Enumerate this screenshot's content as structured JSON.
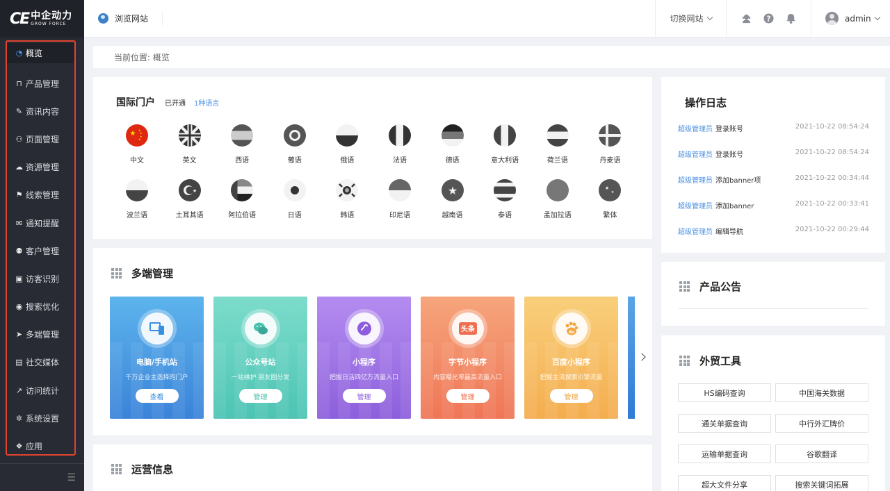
{
  "brand": {
    "mark": "CE",
    "name_cn": "中企动力",
    "name_en": "GROW FORCE"
  },
  "sidebar": {
    "items": [
      {
        "label": "概览",
        "icon": "dashboard-icon",
        "active": true
      },
      {
        "label": "产品管理",
        "icon": "basket-icon"
      },
      {
        "label": "资讯内容",
        "icon": "edit-icon"
      },
      {
        "label": "页面管理",
        "icon": "sitemap-icon"
      },
      {
        "label": "资源管理",
        "icon": "cloud-icon"
      },
      {
        "label": "线索管理",
        "icon": "flag-icon"
      },
      {
        "label": "通知提醒",
        "icon": "chat-icon"
      },
      {
        "label": "客户管理",
        "icon": "users-icon"
      },
      {
        "label": "访客识别",
        "icon": "id-card-icon"
      },
      {
        "label": "搜索优化",
        "icon": "target-icon"
      },
      {
        "label": "多端管理",
        "icon": "send-icon"
      },
      {
        "label": "社交媒体",
        "icon": "social-icon"
      },
      {
        "label": "访问统计",
        "icon": "line-chart-icon"
      },
      {
        "label": "系统设置",
        "icon": "gear-icon"
      },
      {
        "label": "应用",
        "icon": "apps-icon"
      }
    ],
    "collapse_icon": "menu-collapse-icon"
  },
  "header": {
    "browse_label": "浏览网站",
    "switch_label": "切换网站",
    "username": "admin",
    "icons": [
      "service-icon",
      "help-icon",
      "bell-icon"
    ]
  },
  "breadcrumb": {
    "text": "当前位置:  概览"
  },
  "portal": {
    "title": "国际门户",
    "opened": "已开通",
    "count_link": "1种语言",
    "languages": [
      {
        "label": "中文",
        "flag": "china"
      },
      {
        "label": "英文",
        "flag": "uk"
      },
      {
        "label": "西语",
        "flag": "spain"
      },
      {
        "label": "葡语",
        "flag": "portugal"
      },
      {
        "label": "俄语",
        "flag": "russia"
      },
      {
        "label": "法语",
        "flag": "france"
      },
      {
        "label": "德语",
        "flag": "germany"
      },
      {
        "label": "意大利语",
        "flag": "italy"
      },
      {
        "label": "荷兰语",
        "flag": "netherlands"
      },
      {
        "label": "丹麦语",
        "flag": "denmark"
      },
      {
        "label": "波兰语",
        "flag": "poland"
      },
      {
        "label": "土耳其语",
        "flag": "turkey"
      },
      {
        "label": "阿拉伯语",
        "flag": "uae"
      },
      {
        "label": "日语",
        "flag": "japan"
      },
      {
        "label": "韩语",
        "flag": "korea"
      },
      {
        "label": "印尼语",
        "flag": "indonesia"
      },
      {
        "label": "越南语",
        "flag": "vietnam"
      },
      {
        "label": "泰语",
        "flag": "thailand"
      },
      {
        "label": "孟加拉语",
        "flag": "bangladesh"
      },
      {
        "label": "繁体",
        "flag": "taiwan"
      }
    ]
  },
  "multi": {
    "title": "多端管理",
    "tiles": [
      {
        "title": "电脑/手机站",
        "desc": "千万企业主选择的门户",
        "button": "查看",
        "color_top": "#5db4ec",
        "color_bottom": "#3a83d9",
        "icon": "devices-icon",
        "accent": "#3a8ee0"
      },
      {
        "title": "公众号站",
        "desc": "一站维护 朋友圈分发",
        "button": "管理",
        "color_top": "#7ddccb",
        "color_bottom": "#4cc4b4",
        "icon": "wechat-icon",
        "accent": "#4bc2b0"
      },
      {
        "title": "小程序",
        "desc": "把握日活四亿万流量入口",
        "button": "管理",
        "color_top": "#b48cf0",
        "color_bottom": "#8d5fdc",
        "icon": "miniprogram-icon",
        "accent": "#8c5ddc"
      },
      {
        "title": "字节小程序",
        "desc": "内容曝光率最高流量入口",
        "button": "管理",
        "color_top": "#f6a57c",
        "color_bottom": "#ef7656",
        "icon": "toutiao-icon",
        "accent": "#ee6f4f"
      },
      {
        "title": "百度小程序",
        "desc": "把握主流搜索引擎流量",
        "button": "管理",
        "color_top": "#f9cf7b",
        "color_bottom": "#f4ad4f",
        "icon": "baidu-icon",
        "accent": "#f2a63e"
      }
    ]
  },
  "ops": {
    "title": "运营信息"
  },
  "log": {
    "title": "操作日志",
    "entries": [
      {
        "user": "超级管理员",
        "action": "登录账号",
        "time": "2021-10-22 08:54:24"
      },
      {
        "user": "超级管理员",
        "action": "登录账号",
        "time": "2021-10-22 08:54:24"
      },
      {
        "user": "超级管理员",
        "action": "添加banner项",
        "time": "2021-10-22 00:34:44"
      },
      {
        "user": "超级管理员",
        "action": "添加banner",
        "time": "2021-10-22 00:33:41"
      },
      {
        "user": "超级管理员",
        "action": "编辑导航",
        "time": "2021-10-22 00:29:44"
      }
    ]
  },
  "notice": {
    "title": "产品公告"
  },
  "tools": {
    "title": "外贸工具",
    "buttons": [
      "HS编码查询",
      "中国海关数据",
      "通关单据查询",
      "中行外汇牌价",
      "运输单据查询",
      "谷歌翻译",
      "超大文件分享",
      "搜索关键词拓展"
    ]
  }
}
